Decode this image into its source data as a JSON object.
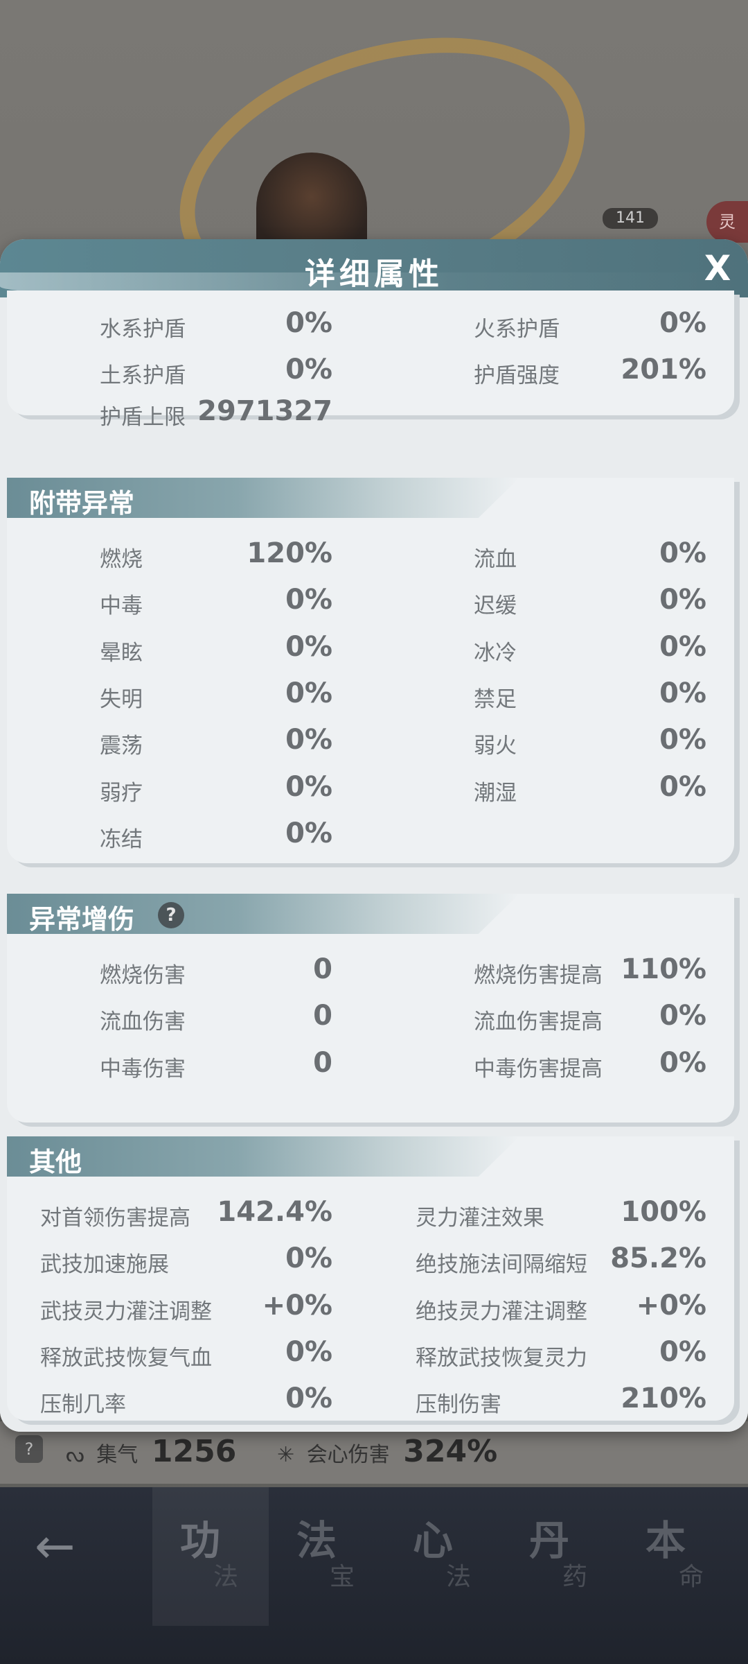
{
  "background": {
    "level": "141",
    "side_tag": "灵",
    "stats": [
      {
        "label": "集气",
        "value": "1256"
      },
      {
        "label": "会心伤害",
        "value": "324%"
      }
    ],
    "help": "?",
    "nav": {
      "back": "←",
      "tabs": [
        {
          "big": "功",
          "small": "法"
        },
        {
          "big": "法",
          "small": "宝"
        },
        {
          "big": "心",
          "small": "法"
        },
        {
          "big": "丹",
          "small": "药"
        },
        {
          "big": "本",
          "small": "命"
        }
      ]
    }
  },
  "dialog": {
    "title": "详细属性",
    "close": "X",
    "shield": {
      "rows": [
        {
          "l_label": "水系护盾",
          "l_value": "0%",
          "r_label": "火系护盾",
          "r_value": "0%"
        },
        {
          "l_label": "土系护盾",
          "l_value": "0%",
          "r_label": "护盾强度",
          "r_value": "201%"
        },
        {
          "l_label": "护盾上限",
          "l_value": "2971327",
          "r_label": "",
          "r_value": ""
        }
      ]
    },
    "status_effects": {
      "title": "附带异常",
      "rows": [
        {
          "l_label": "燃烧",
          "l_value": "120%",
          "r_label": "流血",
          "r_value": "0%"
        },
        {
          "l_label": "中毒",
          "l_value": "0%",
          "r_label": "迟缓",
          "r_value": "0%"
        },
        {
          "l_label": "晕眩",
          "l_value": "0%",
          "r_label": "冰冷",
          "r_value": "0%"
        },
        {
          "l_label": "失明",
          "l_value": "0%",
          "r_label": "禁足",
          "r_value": "0%"
        },
        {
          "l_label": "震荡",
          "l_value": "0%",
          "r_label": "弱火",
          "r_value": "0%"
        },
        {
          "l_label": "弱疗",
          "l_value": "0%",
          "r_label": "潮湿",
          "r_value": "0%"
        },
        {
          "l_label": "冻结",
          "l_value": "0%",
          "r_label": "",
          "r_value": ""
        }
      ]
    },
    "status_damage": {
      "title": "异常增伤",
      "help": "?",
      "rows": [
        {
          "l_label": "燃烧伤害",
          "l_value": "0",
          "r_label": "燃烧伤害提高",
          "r_value": "110%"
        },
        {
          "l_label": "流血伤害",
          "l_value": "0",
          "r_label": "流血伤害提高",
          "r_value": "0%"
        },
        {
          "l_label": "中毒伤害",
          "l_value": "0",
          "r_label": "中毒伤害提高",
          "r_value": "0%"
        }
      ]
    },
    "other": {
      "title": "其他",
      "rows": [
        {
          "l_label": "对首领伤害提高",
          "l_value": "142.4%",
          "r_label": "灵力灌注效果",
          "r_value": "100%"
        },
        {
          "l_label": "武技加速施展",
          "l_value": "0%",
          "r_label": "绝技施法间隔缩短",
          "r_value": "85.2%"
        },
        {
          "l_label": "武技灵力灌注调整",
          "l_value": "+0%",
          "r_label": "绝技灵力灌注调整",
          "r_value": "+0%"
        },
        {
          "l_label": "释放武技恢复气血",
          "l_value": "0%",
          "r_label": "释放武技恢复灵力",
          "r_value": "0%"
        },
        {
          "l_label": "压制几率",
          "l_value": "0%",
          "r_label": "压制伤害",
          "r_value": "210%"
        }
      ]
    }
  }
}
